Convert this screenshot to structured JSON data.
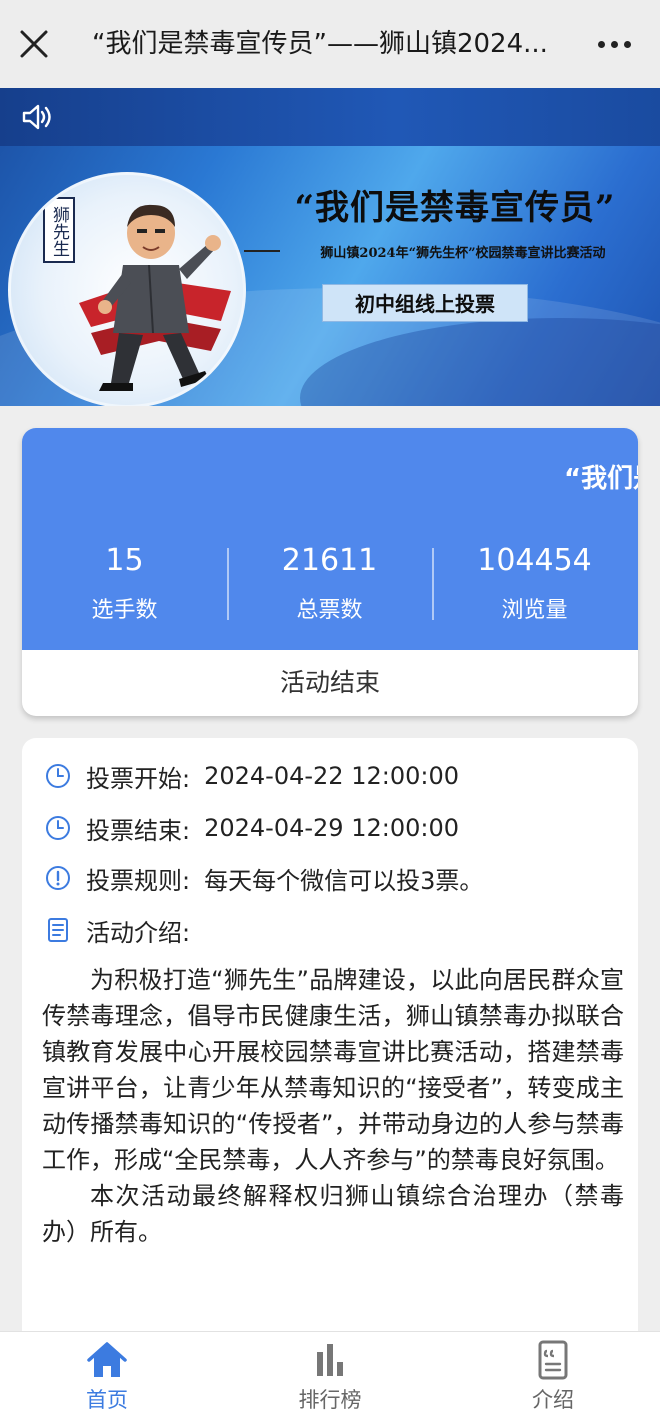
{
  "topbar": {
    "title": "“我们是禁毒宣传员”——狮山镇2024...",
    "close_icon": "close-icon",
    "more_icon": "more-dots-icon"
  },
  "banner": {
    "sound_icon": "speaker-icon",
    "seal_text": "狮先生",
    "title": "“我们是禁毒宣传员”",
    "subtitle": "狮山镇2024年“狮先生杯”校园禁毒宣讲比赛活动",
    "pill": "初中组线上投票"
  },
  "stats": {
    "marquee": "“我们是",
    "items": [
      {
        "value": "15",
        "label": "选手数"
      },
      {
        "value": "21611",
        "label": "总票数"
      },
      {
        "value": "104454",
        "label": "浏览量"
      }
    ],
    "status": "活动结束",
    "colors": {
      "header": "#5088ec"
    }
  },
  "info": {
    "rows": [
      {
        "icon": "clock-icon",
        "label": "投票开始:",
        "value": "2024-04-22 12:00:00"
      },
      {
        "icon": "clock-icon",
        "label": "投票结束:",
        "value": "2024-04-29 12:00:00"
      },
      {
        "icon": "info-circle-icon",
        "label": "投票规则:",
        "value": "每天每个微信可以投3票。"
      },
      {
        "icon": "document-icon",
        "label": "活动介绍:",
        "value": ""
      }
    ],
    "intro": [
      "为积极打造“狮先生”品牌建设，以此向居民群众宣传禁毒理念，倡导市民健康生活，狮山镇禁毒办拟联合镇教育发展中心开展校园禁毒宣讲比赛活动，搭建禁毒宣讲平台，让青少年从禁毒知识的“接受者”，转变成主动传播禁毒知识的“传授者”，并带动身边的人参与禁毒工作，形成“全民禁毒，人人齐参与”的禁毒良好氛围。",
      "本次活动最终解释权归狮山镇综合治理办（禁毒办）所有。"
    ]
  },
  "nav": {
    "items": [
      {
        "icon": "home-icon",
        "label": "首页",
        "active": true
      },
      {
        "icon": "bar-chart-icon",
        "label": "排行榜",
        "active": false
      },
      {
        "icon": "quote-card-icon",
        "label": "介绍",
        "active": false
      }
    ],
    "colors": {
      "active": "#3c7be0",
      "inactive": "#666666"
    }
  }
}
